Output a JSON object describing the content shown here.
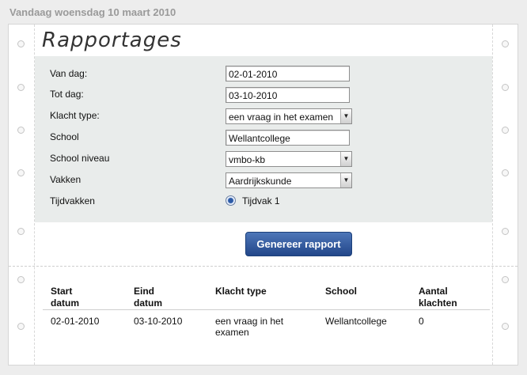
{
  "date_header": "Vandaag woensdag 10 maart 2010",
  "title": "Rapportages",
  "form": {
    "van_dag_label": "Van dag:",
    "van_dag_value": "02-01-2010",
    "tot_dag_label": "Tot dag:",
    "tot_dag_value": "03-10-2010",
    "klacht_type_label": "Klacht type:",
    "klacht_type_value": "een vraag in het examen",
    "school_label": "School",
    "school_value": "Wellantcollege",
    "school_niveau_label": "School niveau",
    "school_niveau_value": "vmbo-kb",
    "vakken_label": "Vakken",
    "vakken_value": "Aardrijkskunde",
    "tijdvakken_label": "Tijdvakken",
    "tijdvak_option": "Tijdvak 1"
  },
  "generate_button": "Genereer rapport",
  "table": {
    "headers": [
      "Start\ndatum",
      "Eind\ndatum",
      "Klacht type",
      "School",
      "Aantal\nklachten"
    ],
    "rows": [
      {
        "start": "02-01-2010",
        "eind": "03-10-2010",
        "klacht": "een vraag in het examen",
        "school": "Wellantcollege",
        "aantal": "0"
      }
    ]
  },
  "colors": {
    "button_top": "#4d76b8",
    "button_bottom": "#23478a",
    "form_panel": "#e9eceb"
  }
}
